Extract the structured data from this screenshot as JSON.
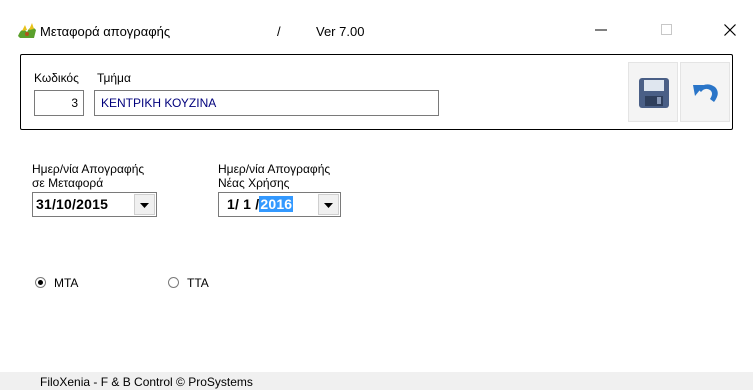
{
  "window": {
    "title": "Μεταφορά απογραφής",
    "separator": "/",
    "version": "Ver  7.00",
    "app_icon": "app-icon"
  },
  "header": {
    "code_label": "Κωδικός",
    "dept_label": "Τμήμα",
    "code_value": "3",
    "dept_value": "ΚΕΝΤΡΙΚΗ ΚΟΥΖΙΝΑ",
    "save_icon": "save-icon",
    "undo_icon": "undo-icon"
  },
  "dates": {
    "transfer_label_line1": "Ημερ/νία Απογραφής",
    "transfer_label_line2": "σε Μεταφορά",
    "transfer_value": "31/10/2015",
    "new_label_line1": "Ημερ/νία Απογραφής",
    "new_label_line2": "Νέας Χρήσης",
    "new_value_prefix": "1/ 1 /",
    "new_value_year": "2016"
  },
  "options": {
    "mta_label": "ΜΤΑ",
    "tta_label": "ΤΤΑ",
    "selected": "ΜΤΑ"
  },
  "status_bar": {
    "text": "FiloXenia - F & B Control  © ProSystems"
  },
  "colors": {
    "selection": "#3399ff",
    "dept_text": "#00007c",
    "save_icon": "#4a5f86",
    "undo_icon": "#2a75c8"
  }
}
